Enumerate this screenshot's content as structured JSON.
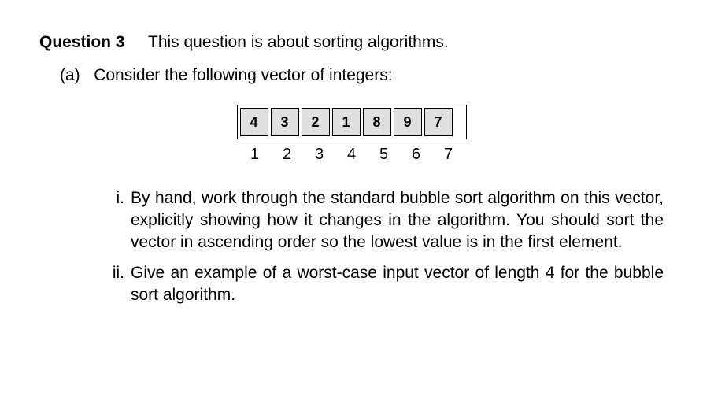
{
  "question": {
    "label": "Question 3",
    "description": "This question is about sorting algorithms."
  },
  "partA": {
    "label": "(a)",
    "text": "Consider the following vector of integers:"
  },
  "vector": {
    "values": [
      "4",
      "3",
      "2",
      "1",
      "8",
      "9",
      "7"
    ],
    "indices": [
      "1",
      "2",
      "3",
      "4",
      "5",
      "6",
      "7"
    ]
  },
  "subparts": {
    "i": {
      "label": "i.",
      "text": "By hand, work through the standard bubble sort algorithm on this vector, explicitly showing how it changes in the algorithm. You should sort the vector in ascending order so the lowest value is in the first element."
    },
    "ii": {
      "label": "ii.",
      "text": "Give an example of a worst-case input vector of length 4 for the bubble sort algorithm."
    }
  }
}
